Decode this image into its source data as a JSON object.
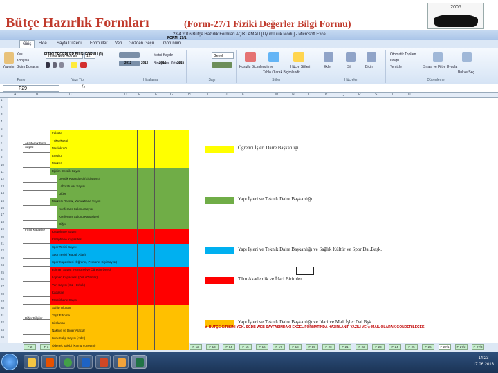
{
  "slide": {
    "title": "Bütçe Hazırlık Formları",
    "subtitle": "(Form-27/1 Fiziki Değerler Bilgi Formu)",
    "logo_year": "2005"
  },
  "window": {
    "doc_title": "23.4.2016 Bütçe Hazırlık Formları AÇIKLAMALI [Uyumluluk Modu] - Microsoft Excel"
  },
  "ribbon_tabs": [
    "Giriş",
    "Ekle",
    "Sayfa Düzeni",
    "Formüller",
    "Veri",
    "Gözden Geçir",
    "Görünüm"
  ],
  "ribbon": {
    "clipboard": {
      "paste": "Yapıştır",
      "cut": "Kes",
      "copy": "Kopyala",
      "format_painter": "Biçim Boyacısı",
      "label": "Pano"
    },
    "font": {
      "name": "Times New Roman",
      "size": "12",
      "label": "Yazı Tipi"
    },
    "alignment": {
      "wrap": "Metni Kaydır",
      "merge": "Birleştir ve Ortala",
      "label": "Hizalama"
    },
    "number": {
      "format": "Genel",
      "label": "Sayı"
    },
    "styles": {
      "conditional": "Koşullu Biçimlendirme",
      "table": "Tablo Olarak Biçimlendir",
      "cell": "Hücre Stilleri",
      "label": "Stiller"
    },
    "cells": {
      "insert": "Ekle",
      "delete": "Sil",
      "format": "Biçim",
      "label": "Hücreler"
    },
    "editing": {
      "autosum": "Otomatik Toplam",
      "fill": "Dolgu",
      "clear": "Temizle",
      "sort": "Sırala ve Filtre Uygula",
      "find": "Bul ve Seç",
      "label": "Düzenleme"
    }
  },
  "formula_bar": {
    "cell_ref": "F29",
    "fx": "fx",
    "value": ""
  },
  "columns": [
    "A",
    "B",
    "C",
    "D",
    "E",
    "F",
    "G",
    "H",
    "I",
    "J",
    "K",
    "L",
    "M",
    "N",
    "O",
    "P",
    "Q",
    "R",
    "S",
    "T",
    "U"
  ],
  "rows": [
    "1",
    "2",
    "3",
    "4",
    "5",
    "6",
    "7",
    "8",
    "9",
    "10",
    "11",
    "12",
    "13",
    "14",
    "15",
    "16",
    "17",
    "18",
    "19",
    "20",
    "21",
    "22",
    "23",
    "24",
    "25",
    "26",
    "27",
    "28",
    "29",
    "30",
    "31",
    "32",
    "33",
    "34",
    "35"
  ],
  "form": {
    "form_no": "FORM: 27/1",
    "title": "FİZİKİ DEĞERLER BİLGİ FORMU (1)",
    "years": [
      "2012",
      "2013",
      "2014",
      "2015"
    ],
    "side_label_1": "Akademik Birim Sayısı",
    "side_label_2": "Fiziki Kapasite",
    "side_label_3": "Diğer Bilgiler",
    "rows": [
      {
        "label": "Fakülte",
        "color": "#ffff00"
      },
      {
        "label": "Yüksekokul",
        "color": "#ffff00"
      },
      {
        "label": "Meslek YO",
        "color": "#ffff00"
      },
      {
        "label": "Enstitü",
        "color": "#ffff00"
      },
      {
        "label": "Merkez",
        "color": "#ffff00"
      },
      {
        "label": "Eğitim Derslik Sayısı",
        "color": "#70ad47"
      },
      {
        "label": "Derslik Kapasitesi (Kişi sayısı)",
        "color": "#70ad47"
      },
      {
        "label": "Laboratuvar Sayısı",
        "color": "#70ad47"
      },
      {
        "label": "Diğer",
        "color": "#70ad47"
      },
      {
        "label": "Merkezi Derslik, Yemekhane Sayısı",
        "color": "#70ad47"
      },
      {
        "label": "Konferans Salonu Sayısı",
        "color": "#70ad47"
      },
      {
        "label": "Konferans Salonu Kapasitesi",
        "color": "#70ad47"
      },
      {
        "label": "Diğer",
        "color": "#70ad47"
      },
      {
        "label": "Kütüphane Sayısı",
        "color": "#ff0000"
      },
      {
        "label": "Kütüphane Kapasitesi",
        "color": "#ff0000"
      },
      {
        "label": "Spor Tesisi Sayısı",
        "color": "#00b0f0"
      },
      {
        "label": "Spor Tesisi (Kapalı Alan)",
        "color": "#00b0f0"
      },
      {
        "label": "Spor Kapasitesi (Öğrenci, Personel Kişi Sayısı)",
        "color": "#00b0f0"
      },
      {
        "label": "Lojman Sayısı (Personel ve Öğretim Üyesi)",
        "color": "#ff0000"
      },
      {
        "label": "Lojman Kapasitesi (Dolu Olanlar)",
        "color": "#ff0000"
      },
      {
        "label": "Yurt Sayısı (Kız - Erkek)",
        "color": "#ff0000"
      },
      {
        "label": "Kapasite",
        "color": "#ff0000"
      },
      {
        "label": "Misafirhane Sayısı",
        "color": "#ff0000"
      },
      {
        "label": "Sahip Olunan",
        "color": "#ffc000"
      },
      {
        "label": "Taşıt Edinme",
        "color": "#ffc000"
      },
      {
        "label": "Kiralanan",
        "color": "#ffc000"
      },
      {
        "label": "Nakliye ve Diğer Araçlar",
        "color": "#ffc000"
      },
      {
        "label": "Kuru Kalıp Sayısı (Adet)",
        "color": "#ffc000"
      },
      {
        "label": "Ödenek Talebi (Kamu Yönetimi)",
        "color": "#ffc000"
      }
    ]
  },
  "legend": [
    {
      "color": "#ffff00",
      "text": "Öğrenci İşleri Daire Başkanlığı"
    },
    {
      "color": "#70ad47",
      "text": "Yapı İşleri ve Teknik Daire Başkanlığı"
    },
    {
      "color": "#00b0f0",
      "text": "Yapı İşleri ve Teknik Daire Başkanlığı ve Sağlık Kültür ve Spor Dai.Başk."
    },
    {
      "color": "#ff0000",
      "text": "Tüm Akademik ve İdari Birimler"
    },
    {
      "color": "#ffc000",
      "text": "Yapı İşleri ve Teknik Daire Başkanlığı ve İdari ve Mali İşler Dai.Bşk."
    }
  ],
  "footnote": "★ BÜTÇE GİRİŞİNİ YOK. SGDB WEB SAYFASINDAKİ EXCEL FORMATINDA HAZIRLANIP YAZILI VE ★ MAİL OLARAK GÖNDERİLECEK",
  "sheet_tabs": [
    "F-2",
    "F-3",
    "F-4",
    "F-5",
    "F-6",
    "F-7",
    "F-8",
    "F-9",
    "F-10",
    "F-11",
    "F-12",
    "F-13",
    "F-14",
    "F-15",
    "F-16",
    "F-17",
    "F-18",
    "F-19",
    "F-20",
    "F-21",
    "F-22",
    "F-23",
    "F-24",
    "F-25",
    "F-26",
    "F-27/1",
    "F-27/2",
    "F-27/3"
  ],
  "taskbar": {
    "time": "14:23",
    "date": "17.06.2013"
  }
}
